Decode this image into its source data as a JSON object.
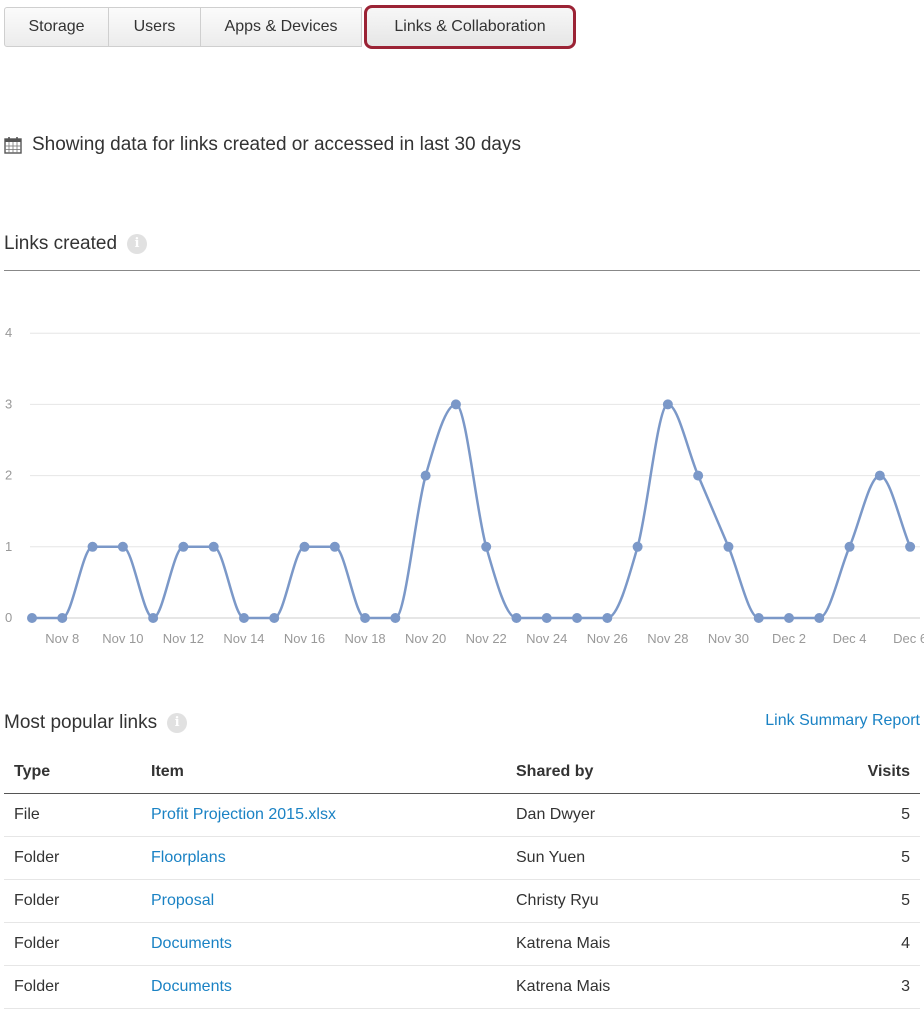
{
  "tabs": [
    {
      "label": "Storage",
      "active": false
    },
    {
      "label": "Users",
      "active": false
    },
    {
      "label": "Apps & Devices",
      "active": false
    },
    {
      "label": "Links & Collaboration",
      "active": true
    }
  ],
  "range_text": "Showing data for links created or accessed in last 30 days",
  "links_created": {
    "title": "Links created",
    "info_icon": "i"
  },
  "chart_data": {
    "type": "line",
    "title": "Links created",
    "xlabel": "",
    "ylabel": "",
    "x": [
      "Nov 7",
      "Nov 8",
      "Nov 9",
      "Nov 10",
      "Nov 11",
      "Nov 12",
      "Nov 13",
      "Nov 14",
      "Nov 15",
      "Nov 16",
      "Nov 17",
      "Nov 18",
      "Nov 19",
      "Nov 20",
      "Nov 21",
      "Nov 22",
      "Nov 23",
      "Nov 24",
      "Nov 25",
      "Nov 26",
      "Nov 27",
      "Nov 28",
      "Nov 29",
      "Nov 30",
      "Dec 1",
      "Dec 2",
      "Dec 3",
      "Dec 4",
      "Dec 5",
      "Dec 6"
    ],
    "values": [
      0,
      0,
      1,
      1,
      0,
      1,
      1,
      0,
      0,
      1,
      1,
      0,
      0,
      2,
      3,
      1,
      0,
      0,
      0,
      0,
      1,
      3,
      2,
      1,
      0,
      0,
      0,
      1,
      2,
      1
    ],
    "x_tick_labels": [
      "Nov 8",
      "Nov 10",
      "Nov 12",
      "Nov 14",
      "Nov 16",
      "Nov 18",
      "Nov 20",
      "Nov 22",
      "Nov 24",
      "Nov 26",
      "Nov 28",
      "Nov 30",
      "Dec 2",
      "Dec 4",
      "Dec 6"
    ],
    "y_ticks": [
      0,
      1,
      2,
      3,
      4
    ],
    "ylim": [
      0,
      4
    ],
    "grid": true,
    "color": "#7b98c8"
  },
  "popular": {
    "title": "Most popular links",
    "info_icon": "i",
    "report_link": "Link Summary Report",
    "columns": {
      "type": "Type",
      "item": "Item",
      "shared_by": "Shared by",
      "visits": "Visits"
    },
    "rows": [
      {
        "type": "File",
        "item": "Profit Projection 2015.xlsx",
        "shared_by": "Dan Dwyer",
        "visits": "5"
      },
      {
        "type": "Folder",
        "item": "Floorplans",
        "shared_by": "Sun Yuen",
        "visits": "5"
      },
      {
        "type": "Folder",
        "item": "Proposal",
        "shared_by": "Christy Ryu",
        "visits": "5"
      },
      {
        "type": "Folder",
        "item": "Documents",
        "shared_by": "Katrena Mais",
        "visits": "4"
      },
      {
        "type": "Folder",
        "item": "Documents",
        "shared_by": "Katrena Mais",
        "visits": "3"
      }
    ]
  }
}
